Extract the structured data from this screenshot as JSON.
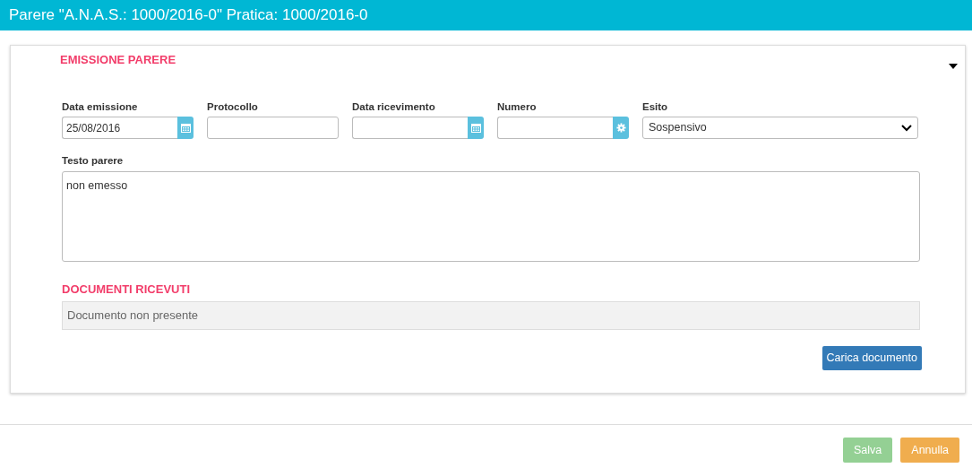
{
  "header": {
    "title": "Parere \"A.N.A.S.: 1000/2016-0\" Pratica: 1000/2016-0"
  },
  "section": {
    "title": "EMISSIONE PARERE",
    "expanded": true
  },
  "fields": [
    {
      "label": "Data emissione",
      "kind": "date",
      "value": "25/08/2016"
    },
    {
      "label": "Protocollo",
      "kind": "text"
    },
    {
      "label": "Data ricevimento",
      "kind": "date"
    },
    {
      "label": "Numero",
      "kind": "generate"
    },
    {
      "label": "Esito",
      "kind": "select",
      "value": "Sospensivo"
    }
  ],
  "testo": {
    "label": "Testo parere",
    "value": "non emesso"
  },
  "documents": {
    "title": "DOCUMENTI RICEVUTI",
    "empty_text": "Documento non presente",
    "upload_button": "Carica documento"
  },
  "footer_buttons": [
    {
      "label": "Salva",
      "kind": "save",
      "disabled": true
    },
    {
      "label": "Annulla",
      "kind": "cancel",
      "disabled": false
    }
  ]
}
